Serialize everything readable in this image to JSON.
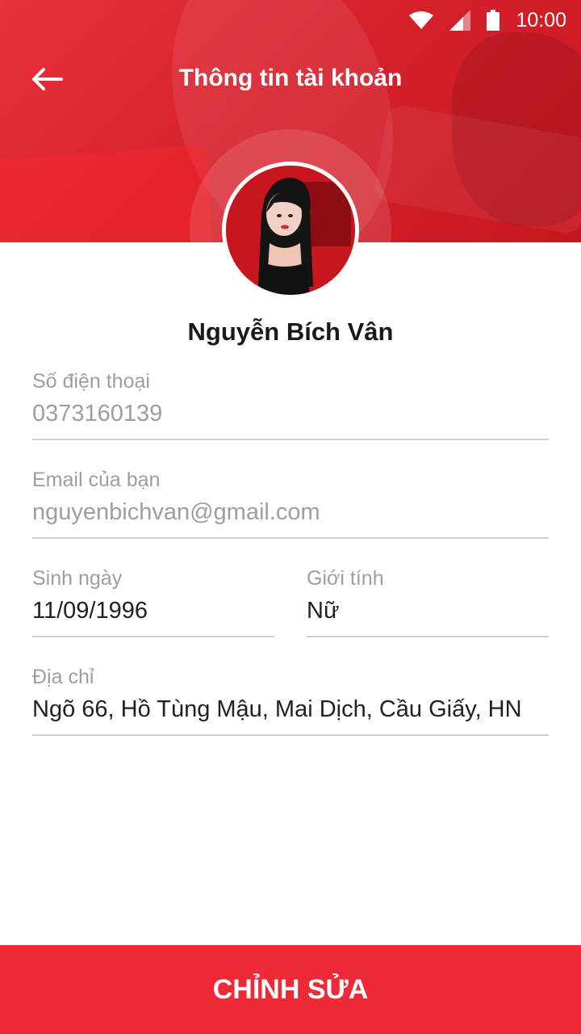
{
  "status_bar": {
    "time": "10:00"
  },
  "app_bar": {
    "title": "Thông tin tài khoản"
  },
  "profile": {
    "name": "Nguyễn Bích Vân"
  },
  "fields": {
    "phone": {
      "label": "Số điện thoại",
      "value": "0373160139"
    },
    "email": {
      "label": "Email của bạn",
      "value": "nguyenbichvan@gmail.com"
    },
    "dob": {
      "label": "Sinh ngày",
      "value": "11/09/1996"
    },
    "gender": {
      "label": "Giới tính",
      "value": "Nữ"
    },
    "address": {
      "label": "Địa chỉ",
      "value": "Ngõ 66, Hồ Tùng Mậu, Mai Dịch, Cầu Giấy, HN"
    }
  },
  "actions": {
    "edit_label": "CHỈNH SỬA"
  },
  "icons": {
    "back": "arrow-left-icon",
    "wifi": "wifi-icon",
    "signal": "signal-icon",
    "battery": "battery-icon"
  },
  "colors": {
    "primary": "#ee2a37",
    "label": "#9e9e9e",
    "text": "#212121",
    "divider": "#d0d0d0"
  }
}
